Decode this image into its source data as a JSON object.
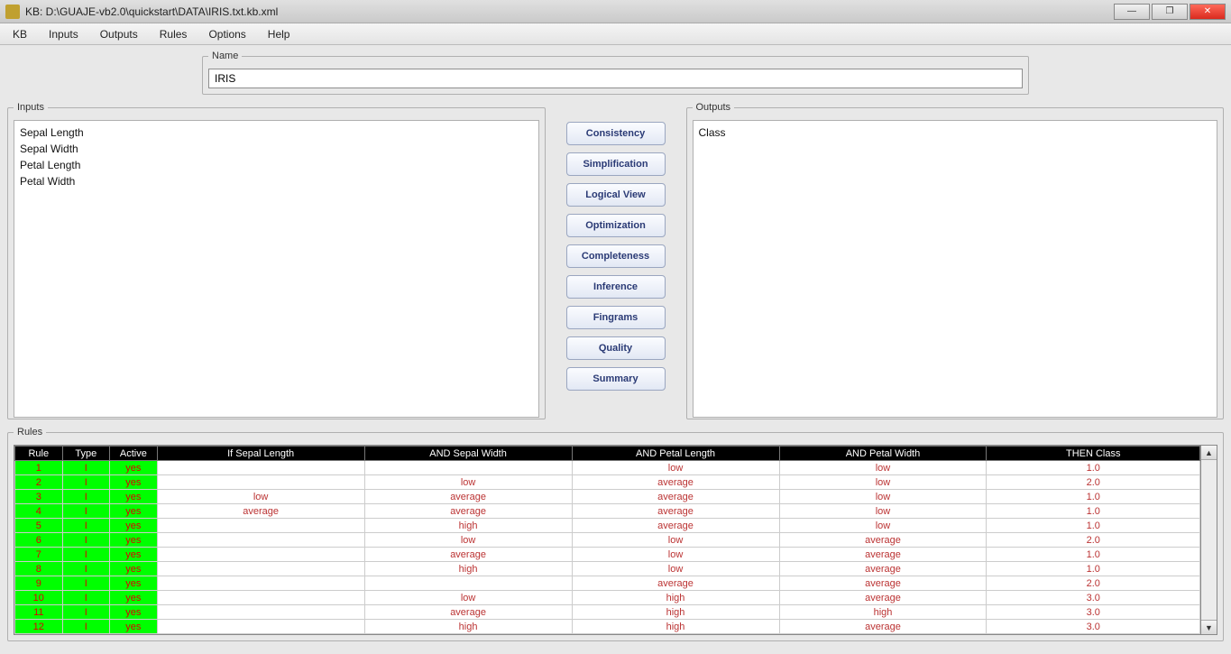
{
  "window": {
    "title": "KB: D:\\GUAJE-vb2.0\\quickstart\\DATA\\IRIS.txt.kb.xml"
  },
  "menu": [
    "KB",
    "Inputs",
    "Outputs",
    "Rules",
    "Options",
    "Help"
  ],
  "name_group": {
    "legend": "Name",
    "value": "IRIS"
  },
  "inputs": {
    "legend": "Inputs",
    "items": [
      "Sepal Length",
      "Sepal Width",
      "Petal Length",
      "Petal Width"
    ]
  },
  "outputs": {
    "legend": "Outputs",
    "items": [
      "Class"
    ]
  },
  "actions": [
    "Consistency",
    "Simplification",
    "Logical View",
    "Optimization",
    "Completeness",
    "Inference",
    "Fingrams",
    "Quality",
    "Summary"
  ],
  "rules": {
    "legend": "Rules",
    "headers": [
      "Rule",
      "Type",
      "Active",
      "If Sepal Length",
      "AND Sepal Width",
      "AND Petal Length",
      "AND Petal Width",
      "THEN Class"
    ],
    "rows": [
      {
        "rule": "1",
        "type": "I",
        "active": "yes",
        "cond": [
          "",
          "",
          "low",
          "low"
        ],
        "then": "1.0"
      },
      {
        "rule": "2",
        "type": "I",
        "active": "yes",
        "cond": [
          "",
          "low",
          "average",
          "low"
        ],
        "then": "2.0"
      },
      {
        "rule": "3",
        "type": "I",
        "active": "yes",
        "cond": [
          "low",
          "average",
          "average",
          "low"
        ],
        "then": "1.0"
      },
      {
        "rule": "4",
        "type": "I",
        "active": "yes",
        "cond": [
          "average",
          "average",
          "average",
          "low"
        ],
        "then": "1.0"
      },
      {
        "rule": "5",
        "type": "I",
        "active": "yes",
        "cond": [
          "",
          "high",
          "average",
          "low"
        ],
        "then": "1.0"
      },
      {
        "rule": "6",
        "type": "I",
        "active": "yes",
        "cond": [
          "",
          "low",
          "low",
          "average"
        ],
        "then": "2.0"
      },
      {
        "rule": "7",
        "type": "I",
        "active": "yes",
        "cond": [
          "",
          "average",
          "low",
          "average"
        ],
        "then": "1.0"
      },
      {
        "rule": "8",
        "type": "I",
        "active": "yes",
        "cond": [
          "",
          "high",
          "low",
          "average"
        ],
        "then": "1.0"
      },
      {
        "rule": "9",
        "type": "I",
        "active": "yes",
        "cond": [
          "",
          "",
          "average",
          "average"
        ],
        "then": "2.0"
      },
      {
        "rule": "10",
        "type": "I",
        "active": "yes",
        "cond": [
          "",
          "low",
          "high",
          "average"
        ],
        "then": "3.0"
      },
      {
        "rule": "11",
        "type": "I",
        "active": "yes",
        "cond": [
          "",
          "average",
          "high",
          "high"
        ],
        "then": "3.0"
      },
      {
        "rule": "12",
        "type": "I",
        "active": "yes",
        "cond": [
          "",
          "high",
          "high",
          "average"
        ],
        "then": "3.0"
      }
    ]
  }
}
